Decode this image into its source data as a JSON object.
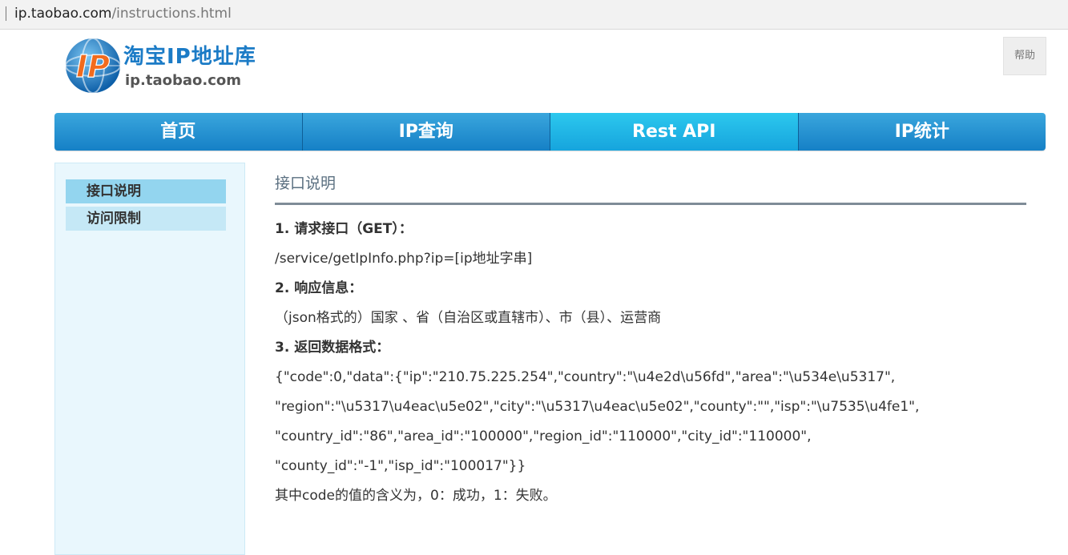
{
  "browser": {
    "url_host": "ip.taobao.com",
    "url_path": "/instructions.html"
  },
  "logo": {
    "title": "淘宝IP地址库",
    "subtitle": "ip.taobao.com",
    "emblem_letters": "IP"
  },
  "header": {
    "help_label": "帮助"
  },
  "nav": {
    "items": [
      {
        "label": "首页"
      },
      {
        "label": "IP查询"
      },
      {
        "label": "Rest API"
      },
      {
        "label": "IP统计"
      }
    ],
    "active_index": 2
  },
  "sidebar": {
    "items": [
      {
        "label": "接口说明"
      },
      {
        "label": "访问限制"
      }
    ]
  },
  "content": {
    "title": "接口说明",
    "lines": [
      "1. 请求接口（GET）：",
      "/service/getIpInfo.php?ip=[ip地址字串]",
      "2. 响应信息：",
      "（json格式的）国家 、省（自治区或直辖市）、市（县）、运营商",
      "3. 返回数据格式：",
      "{\"code\":0,\"data\":{\"ip\":\"210.75.225.254\",\"country\":\"\\u4e2d\\u56fd\",\"area\":\"\\u534e\\u5317\",",
      "\"region\":\"\\u5317\\u4eac\\u5e02\",\"city\":\"\\u5317\\u4eac\\u5e02\",\"county\":\"\",\"isp\":\"\\u7535\\u4fe1\",",
      "\"country_id\":\"86\",\"area_id\":\"100000\",\"region_id\":\"110000\",\"city_id\":\"110000\",",
      "\"county_id\":\"-1\",\"isp_id\":\"100017\"}}",
      "其中code的值的含义为，0：成功，1：失败。"
    ]
  },
  "colors": {
    "nav_blue": "#1f8fd0",
    "nav_active": "#22b8e8",
    "sidebar_bg": "#e9f7fd",
    "sidebar_active": "#93d5ef",
    "logo_blue": "#1b7bc6"
  }
}
